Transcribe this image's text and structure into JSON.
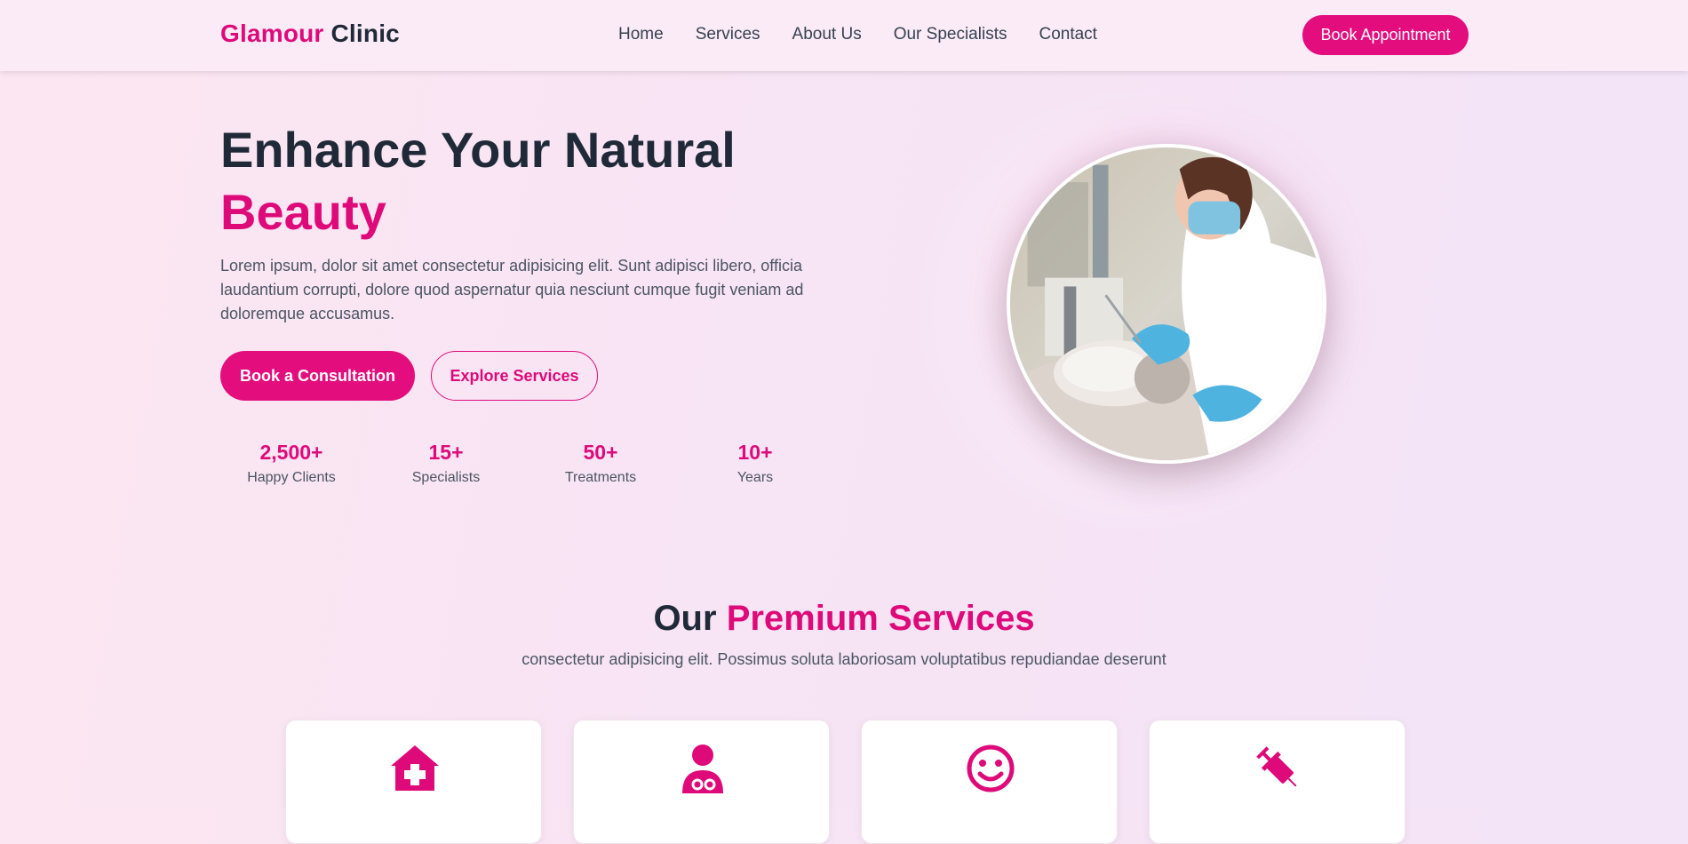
{
  "brand": {
    "name_accent": "Glamour",
    "name_rest": " Clinic"
  },
  "nav": {
    "links": [
      "Home",
      "Services",
      "About Us",
      "Our Specialists",
      "Contact"
    ],
    "cta": "Book Appointment"
  },
  "hero": {
    "title_line1": "Enhance Your Natural",
    "title_line2": "Beauty",
    "description": "Lorem ipsum, dolor sit amet consectetur adipisicing elit. Sunt adipisci libero, officia laudantium corrupti, dolore quod aspernatur quia nesciunt cumque fugit veniam ad doloremque accusamus.",
    "primary_cta": "Book a Consultation",
    "secondary_cta": "Explore Services",
    "stats": [
      {
        "value": "2,500+",
        "label": "Happy Clients"
      },
      {
        "value": "15+",
        "label": "Specialists"
      },
      {
        "value": "50+",
        "label": "Treatments"
      },
      {
        "value": "10+",
        "label": "Years"
      }
    ]
  },
  "services": {
    "title_dark": "Our",
    "title_pink": "Premium Services",
    "subtitle": "consectetur adipisicing elit. Possimus soluta laboriosam voluptatibus repudiandae deserunt",
    "cards": [
      {
        "icon": "clinic-medical-icon"
      },
      {
        "icon": "doctor-icon"
      },
      {
        "icon": "smile-icon"
      },
      {
        "icon": "syringe-icon"
      }
    ]
  },
  "colors": {
    "accent": "#e30d7e",
    "dark": "#1f2937",
    "muted": "#4b5563"
  }
}
